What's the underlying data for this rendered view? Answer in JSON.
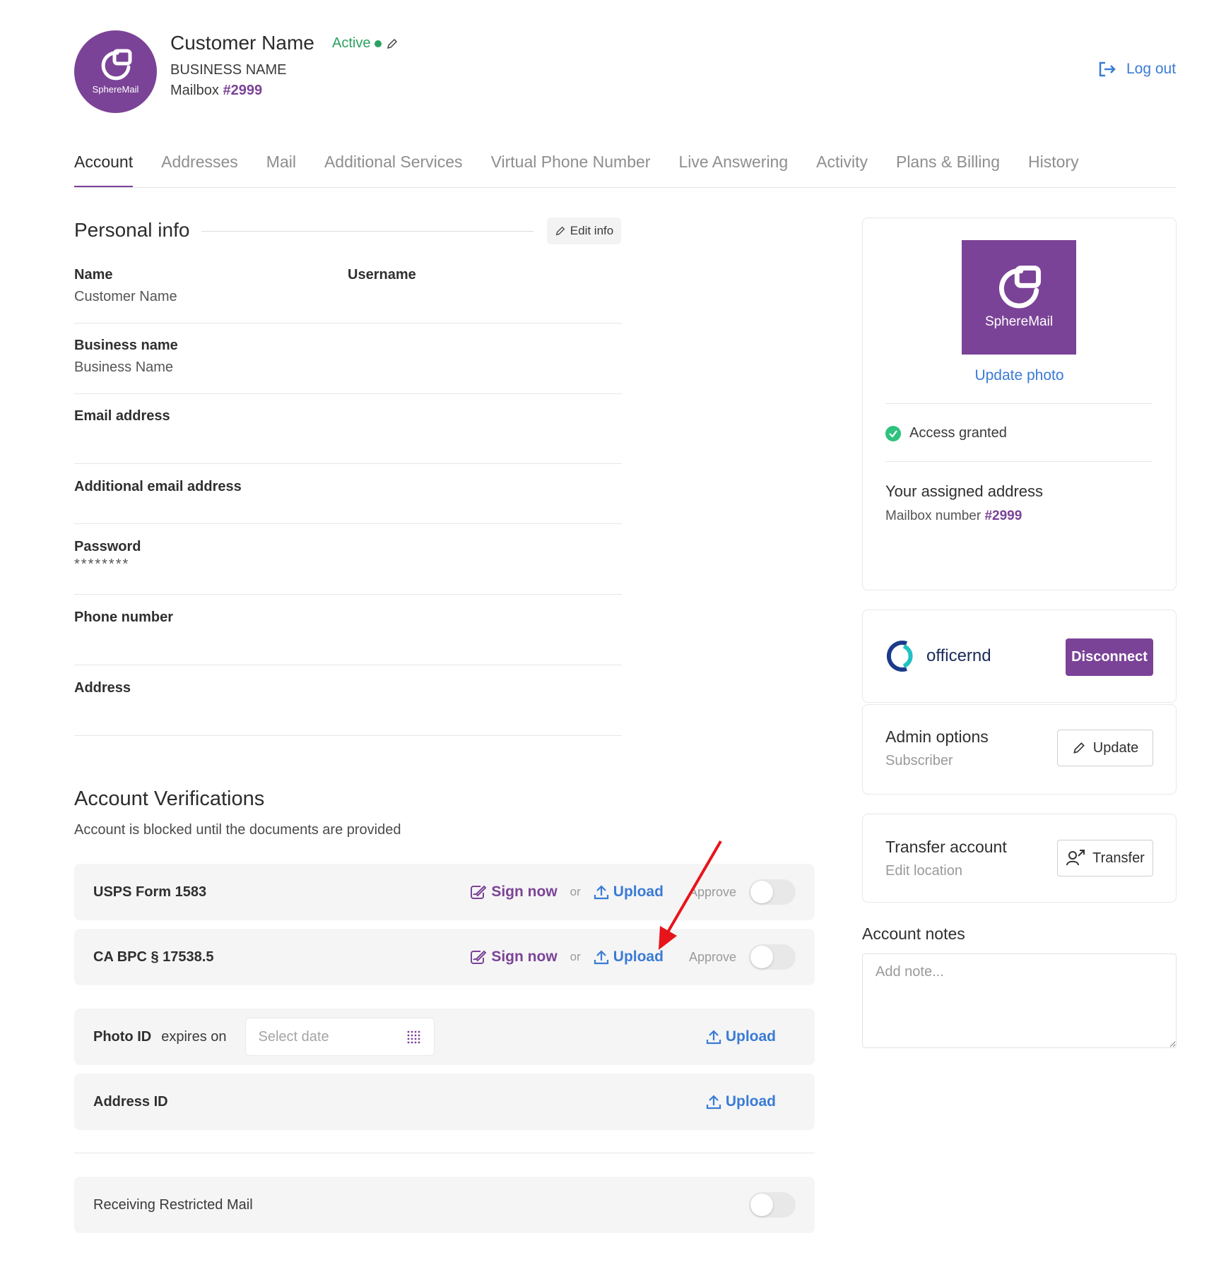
{
  "header": {
    "avatar_logo_text": "SphereMail",
    "customer_name": "Customer Name",
    "status": "Active",
    "business_name": "BUSINESS NAME",
    "mailbox_label": "Mailbox",
    "mailbox_number": "#2999",
    "logout_label": "Log out"
  },
  "tabs": [
    {
      "label": "Account",
      "active": true
    },
    {
      "label": "Addresses"
    },
    {
      "label": "Mail"
    },
    {
      "label": "Additional Services"
    },
    {
      "label": "Virtual Phone Number"
    },
    {
      "label": "Live Answering"
    },
    {
      "label": "Activity"
    },
    {
      "label": "Plans & Billing"
    },
    {
      "label": "History"
    }
  ],
  "personal_info": {
    "title": "Personal info",
    "edit_label": "Edit info",
    "fields": {
      "name": {
        "label": "Name",
        "value": "Customer Name"
      },
      "username": {
        "label": "Username",
        "value": ""
      },
      "business_name": {
        "label": "Business name",
        "value": "Business Name"
      },
      "email": {
        "label": "Email address",
        "value": ""
      },
      "additional_email": {
        "label": "Additional email address",
        "value": ""
      },
      "password": {
        "label": "Password",
        "value": "********"
      },
      "phone": {
        "label": "Phone number",
        "value": ""
      },
      "address": {
        "label": "Address",
        "value": ""
      }
    }
  },
  "verifications": {
    "title": "Account Verifications",
    "subtitle": "Account is blocked until the documents are provided",
    "sign_now_label": "Sign now",
    "or_label": "or",
    "upload_label": "Upload",
    "approve_label": "Approve",
    "rows": {
      "usps": {
        "label": "USPS Form 1583",
        "approved": false
      },
      "ca_bpc": {
        "label": "CA BPC § 17538.5",
        "approved": false
      },
      "photo_id": {
        "label": "Photo ID",
        "expires_label": "expires on",
        "date_placeholder": "Select date"
      },
      "address_id": {
        "label": "Address ID"
      }
    },
    "restricted": {
      "label": "Receiving Restricted Mail",
      "enabled": false
    }
  },
  "sidebar": {
    "photo_logo_text": "SphereMail",
    "update_photo_label": "Update photo",
    "access_label": "Access granted",
    "assigned_title": "Your assigned address",
    "assigned_mailbox_label": "Mailbox number",
    "assigned_mailbox_number": "#2999",
    "integration_name": "officernd",
    "disconnect_label": "Disconnect",
    "admin_title": "Admin options",
    "admin_sub": "Subscriber",
    "update_label": "Update",
    "transfer_title": "Transfer account",
    "transfer_sub": "Edit location",
    "transfer_label": "Transfer",
    "notes_title": "Account notes",
    "notes_placeholder": "Add note..."
  },
  "colors": {
    "brand_purple": "#7b4397",
    "link_blue": "#3a7bd5",
    "status_green": "#2ba160",
    "annotation_red": "#e8141b"
  }
}
